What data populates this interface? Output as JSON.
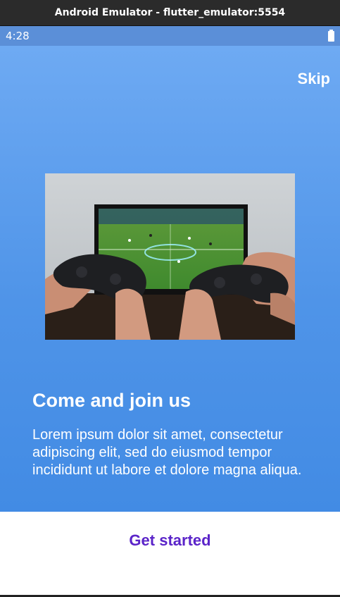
{
  "window": {
    "title": "Android Emulator - flutter_emulator:5554"
  },
  "status_bar": {
    "time": "4:28",
    "battery_icon": "battery-full-icon"
  },
  "onboarding": {
    "skip_label": "Skip",
    "heading": "Come and join us",
    "body": "Lorem ipsum dolor sit amet, consectetur adipiscing elit, sed do eiusmod tempor incididunt ut labore et dolore magna aliqua.",
    "image_alt": "hands holding game controllers in front of a TV showing a soccer game"
  },
  "footer": {
    "cta_label": "Get started"
  },
  "colors": {
    "gradient_top": "#6eaaf3",
    "gradient_bottom": "#428be4",
    "cta": "#5b24c9",
    "status_bar": "#5b8fd8"
  }
}
